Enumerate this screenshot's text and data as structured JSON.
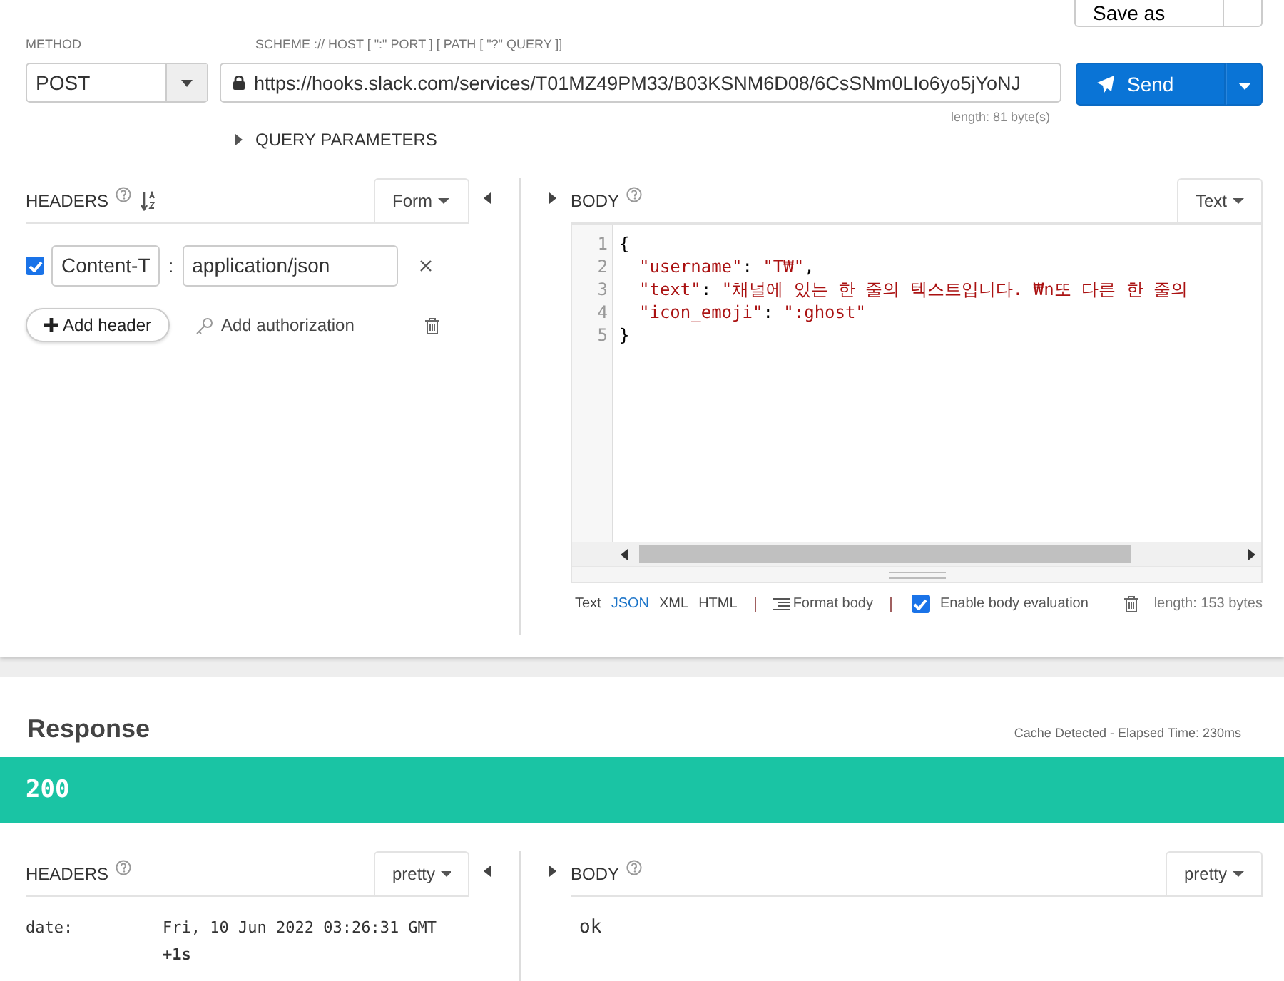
{
  "save_button": {
    "label": "Save as"
  },
  "method": {
    "label": "METHOD",
    "value": "POST"
  },
  "url": {
    "label": "SCHEME :// HOST [ \":\" PORT ] [ PATH [ \"?\" QUERY ]]",
    "value": "https://hooks.slack.com/services/T01MZ49PM33/B03KSNM6D08/6CsSNm0LIo6yo5jYoNJ",
    "length": "length: 81 byte(s)"
  },
  "send_button": {
    "label": "Send"
  },
  "query_parameters": {
    "label": "QUERY PARAMETERS",
    "expanded": false
  },
  "request_headers": {
    "title": "HEADERS",
    "mode": "Form",
    "rows": [
      {
        "checked": true,
        "name": "Content-T",
        "separator": ":",
        "value": "application/json"
      }
    ],
    "add_header": "Add header",
    "add_authorization": "Add authorization"
  },
  "request_body": {
    "title": "BODY",
    "mode": "Text",
    "lines": [
      {
        "number": "1",
        "indented": false,
        "tokens": [
          {
            "kind": "punct",
            "text": "{"
          }
        ]
      },
      {
        "number": "2",
        "indented": true,
        "tokens": [
          {
            "kind": "string",
            "text": "\"username\""
          },
          {
            "kind": "punct",
            "text": ": "
          },
          {
            "kind": "string",
            "text": "\"T₩\""
          },
          {
            "kind": "punct",
            "text": ","
          }
        ]
      },
      {
        "number": "3",
        "indented": true,
        "tokens": [
          {
            "kind": "string",
            "text": "\"text\""
          },
          {
            "kind": "punct",
            "text": ": "
          },
          {
            "kind": "string",
            "text": "\"채널에 있는 한 줄의 텍스트입니다. ₩n또 다른 한 줄의"
          }
        ]
      },
      {
        "number": "4",
        "indented": true,
        "tokens": [
          {
            "kind": "string",
            "text": "\"icon_emoji\""
          },
          {
            "kind": "punct",
            "text": ": "
          },
          {
            "kind": "string",
            "text": "\":ghost\""
          }
        ]
      },
      {
        "number": "5",
        "indented": false,
        "tokens": [
          {
            "kind": "punct",
            "text": "}"
          }
        ]
      }
    ],
    "formats": [
      {
        "label": "Text",
        "selected": false
      },
      {
        "label": "JSON",
        "selected": true
      },
      {
        "label": "XML",
        "selected": false
      },
      {
        "label": "HTML",
        "selected": false
      }
    ],
    "format_body": "Format body",
    "evaluation": {
      "label": "Enable body evaluation",
      "checked": true
    },
    "length": "length: 153 bytes"
  },
  "response": {
    "title": "Response",
    "meta": "Cache Detected - Elapsed Time: 230ms",
    "status": "200",
    "headers": {
      "title": "HEADERS",
      "mode": "pretty",
      "rows": [
        {
          "name": "date:",
          "value": "Fri, 10 Jun 2022 03:26:31 GMT **+1s**"
        }
      ]
    },
    "body": {
      "title": "BODY",
      "mode": "pretty",
      "text": "ok"
    }
  }
}
